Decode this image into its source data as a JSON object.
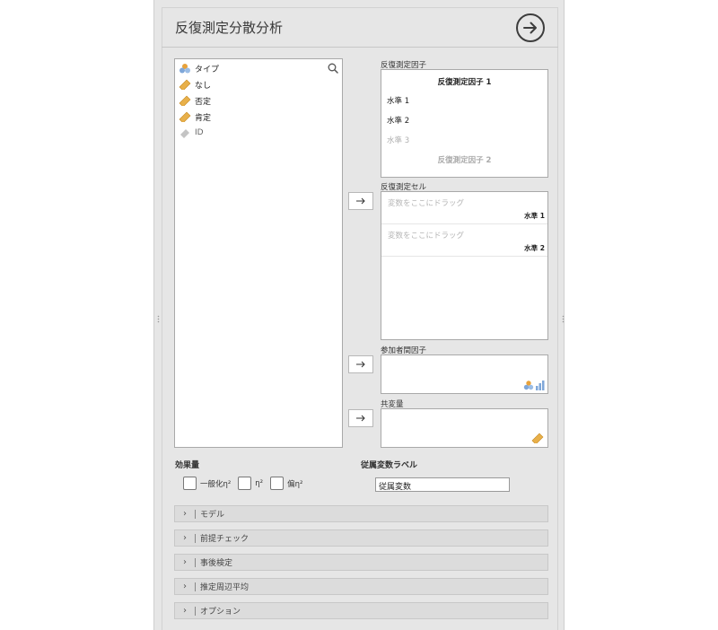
{
  "title": "反復測定分散分析",
  "variables": [
    {
      "name": "タイプ",
      "icon": "nominal-icon"
    },
    {
      "name": "なし",
      "icon": "ruler-icon"
    },
    {
      "name": "否定",
      "icon": "ruler-icon"
    },
    {
      "name": "肯定",
      "icon": "ruler-icon"
    },
    {
      "name": "ID",
      "icon": "id-icon"
    }
  ],
  "rm_factors": {
    "label": "反復測定因子",
    "factor1": "反復測定因子 1",
    "levels": [
      "水準 1",
      "水準 2",
      "水準 3"
    ],
    "factor2": "反復測定因子 2"
  },
  "rm_cells": {
    "label": "反復測定セル",
    "rows": [
      {
        "placeholder": "変数をここにドラッグ",
        "level": "水準 1"
      },
      {
        "placeholder": "変数をここにドラッグ",
        "level": "水準 2"
      }
    ]
  },
  "between_factors": {
    "label": "参加者間因子"
  },
  "covariates": {
    "label": "共変量"
  },
  "effect_size": {
    "label": "効果量",
    "options": [
      {
        "label": "一般化η²",
        "checked": false
      },
      {
        "label": "η²",
        "checked": false
      },
      {
        "label": "偏η²",
        "checked": false
      }
    ]
  },
  "dv_label": {
    "label": "従属変数ラベル",
    "value": "従属変数"
  },
  "sections": [
    "モデル",
    "前提チェック",
    "事後検定",
    "推定周辺平均",
    "オプション"
  ],
  "colors": {
    "accent": "#e8a23a",
    "panel": "#e6e6e6"
  }
}
